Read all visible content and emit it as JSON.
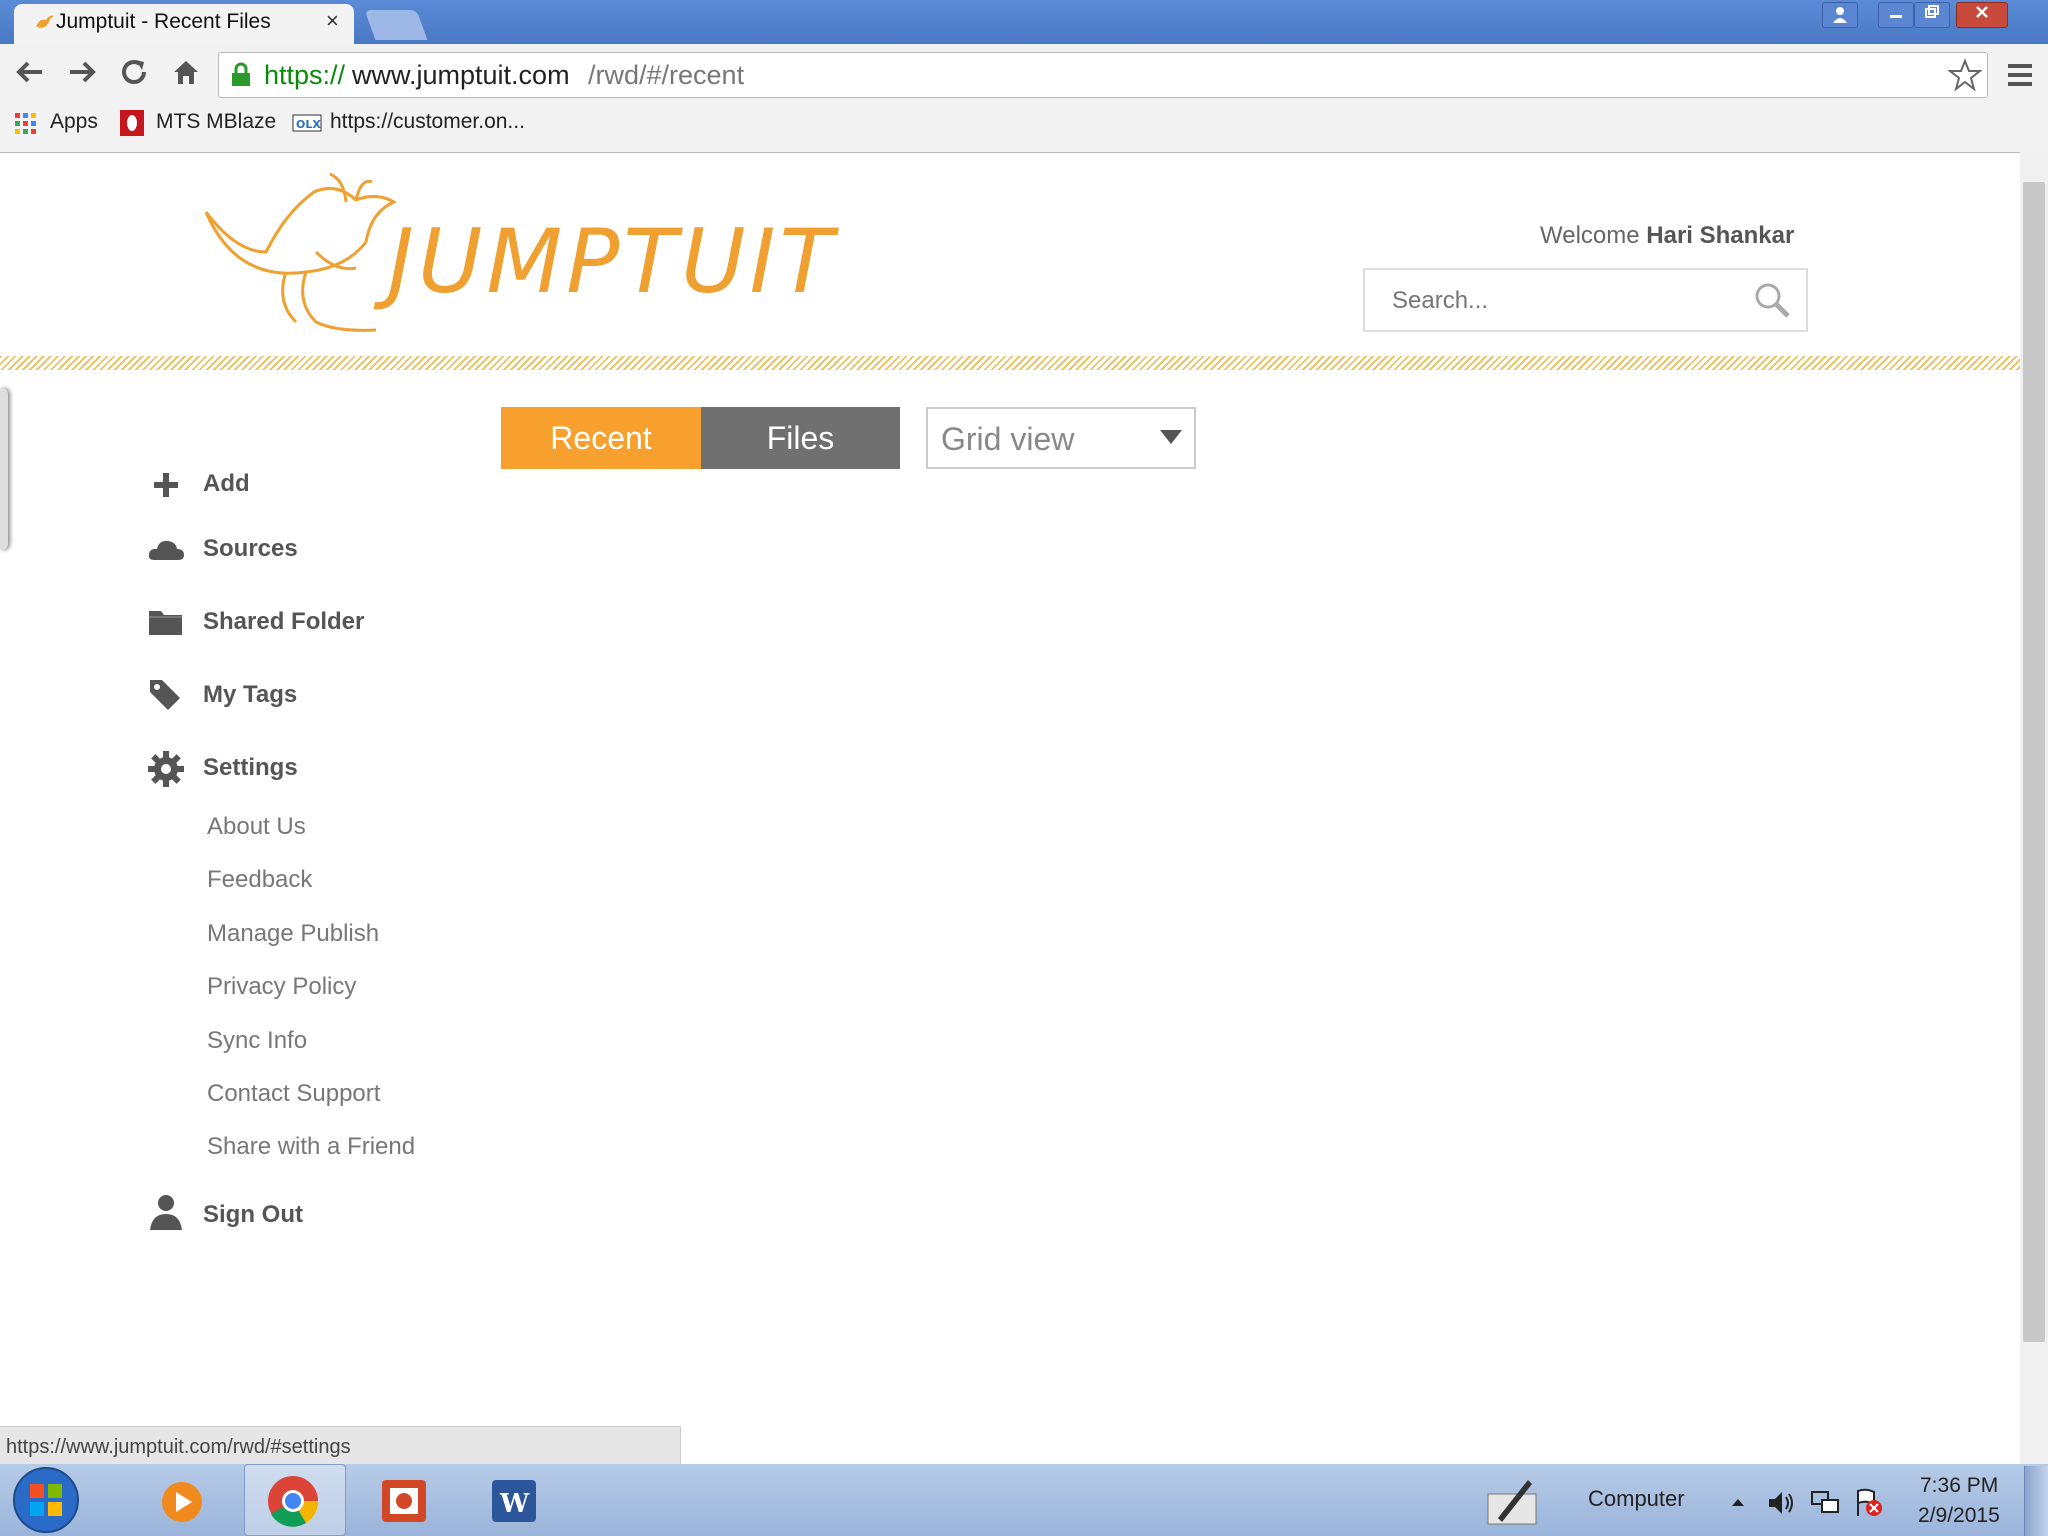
{
  "browser": {
    "tab_title": "Jumptuit - Recent Files",
    "tab_close": "×",
    "url_scheme": "https://",
    "url_host": "www.jumptuit.com",
    "url_path": "/rwd/#/recent",
    "bookmarks": [
      "Apps",
      "MTS MBlaze",
      "https://customer.on..."
    ],
    "status_url": "https://www.jumptuit.com/rwd/#settings"
  },
  "header": {
    "logo": "JUMPTUIT",
    "welcome_prefix": "Welcome",
    "user_name": "Hari Shankar",
    "search_placeholder": "Search..."
  },
  "tabs": {
    "recent": "Recent",
    "files": "Files",
    "view": "Grid view"
  },
  "sidebar": {
    "items": [
      "Add",
      "Sources",
      "Shared Folder",
      "My Tags",
      "Settings"
    ],
    "settings_sub": [
      "About Us",
      "Feedback",
      "Manage Publish",
      "Privacy Policy",
      "Sync Info",
      "Contact Support",
      "Share with a Friend"
    ],
    "sign_out": "Sign Out"
  },
  "taskbar": {
    "computer": "Computer",
    "time": "7:36 PM",
    "date": "2/9/2015"
  },
  "colors": {
    "accent": "#f7a02d",
    "tab_inactive": "#707070"
  }
}
